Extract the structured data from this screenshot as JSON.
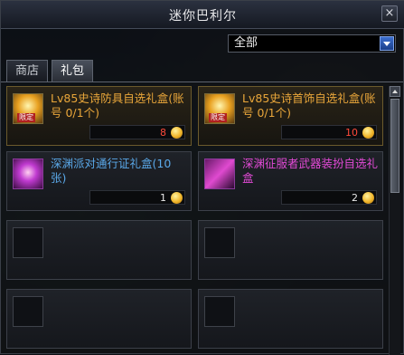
{
  "window": {
    "title": "迷你巴利尔",
    "close_label": "×"
  },
  "filter": {
    "selected": "全部"
  },
  "tabs": [
    {
      "label": "商店",
      "active": false
    },
    {
      "label": "礼包",
      "active": true
    }
  ],
  "items": [
    {
      "name": "Lv85史诗防具自选礼盒(账号 0/1个)",
      "name_color": "gold",
      "price": "8",
      "price_color": "red",
      "icon": "limited-gift-box-icon",
      "icon_badge": "限定"
    },
    {
      "name": "Lv85史诗首饰自选礼盒(账号 0/1个)",
      "name_color": "gold",
      "price": "10",
      "price_color": "red",
      "icon": "limited-gift-box-icon",
      "icon_badge": "限定"
    },
    {
      "name": "深渊派对通行证礼盒(10张)",
      "name_color": "blue",
      "price": "1",
      "price_color": "white",
      "icon": "abyss-pass-box-icon",
      "icon_badge": ""
    },
    {
      "name": "深渊征服者武器装扮自选礼盒",
      "name_color": "pink",
      "price": "2",
      "price_color": "white",
      "icon": "weapon-avatar-box-icon",
      "icon_badge": ""
    }
  ],
  "colors": {
    "gold_text": "#e9a63a",
    "blue_text": "#5aa8e8",
    "pink_text": "#e24ad6",
    "price_red": "#ff4a3a"
  }
}
